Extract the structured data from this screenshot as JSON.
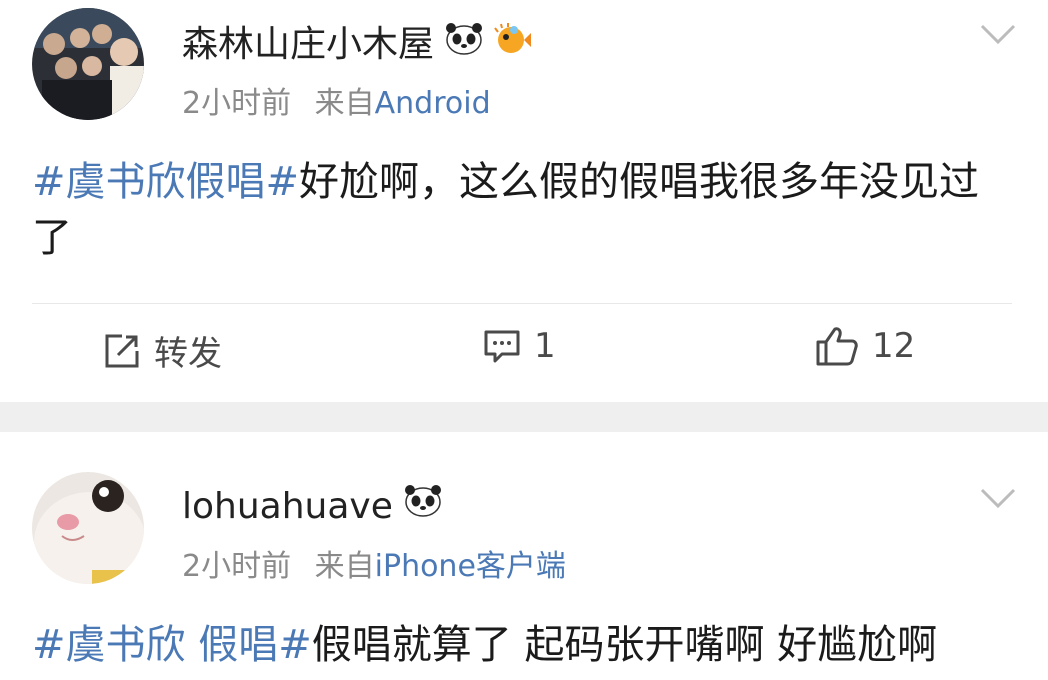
{
  "posts": [
    {
      "username": "森林山庄小木屋",
      "time": "2小时前",
      "from_prefix": "来自",
      "source": "Android",
      "tag": "#虞书欣假唱#",
      "text": "好尬啊，这么假的假唱我很多年没见过了",
      "repost_label": "转发",
      "comment_count": "1",
      "like_count": "12"
    },
    {
      "username": "lohuahuave",
      "time": "2小时前",
      "from_prefix": "来自",
      "source": "iPhone客户端",
      "tag": "#虞书欣 假唱#",
      "text": "假唱就算了 起码张开嘴啊 好尴尬啊"
    }
  ],
  "icons": {
    "verified": "panda-emoji-icon",
    "fish": "pufferfish-emoji-icon",
    "menu": "chevron-down-icon",
    "repost": "repost-icon",
    "comment": "comment-icon",
    "like": "thumbs-up-icon"
  },
  "colors": {
    "link": "#4b79b5",
    "meta": "#8a8a8a",
    "separator": "#efefef"
  }
}
